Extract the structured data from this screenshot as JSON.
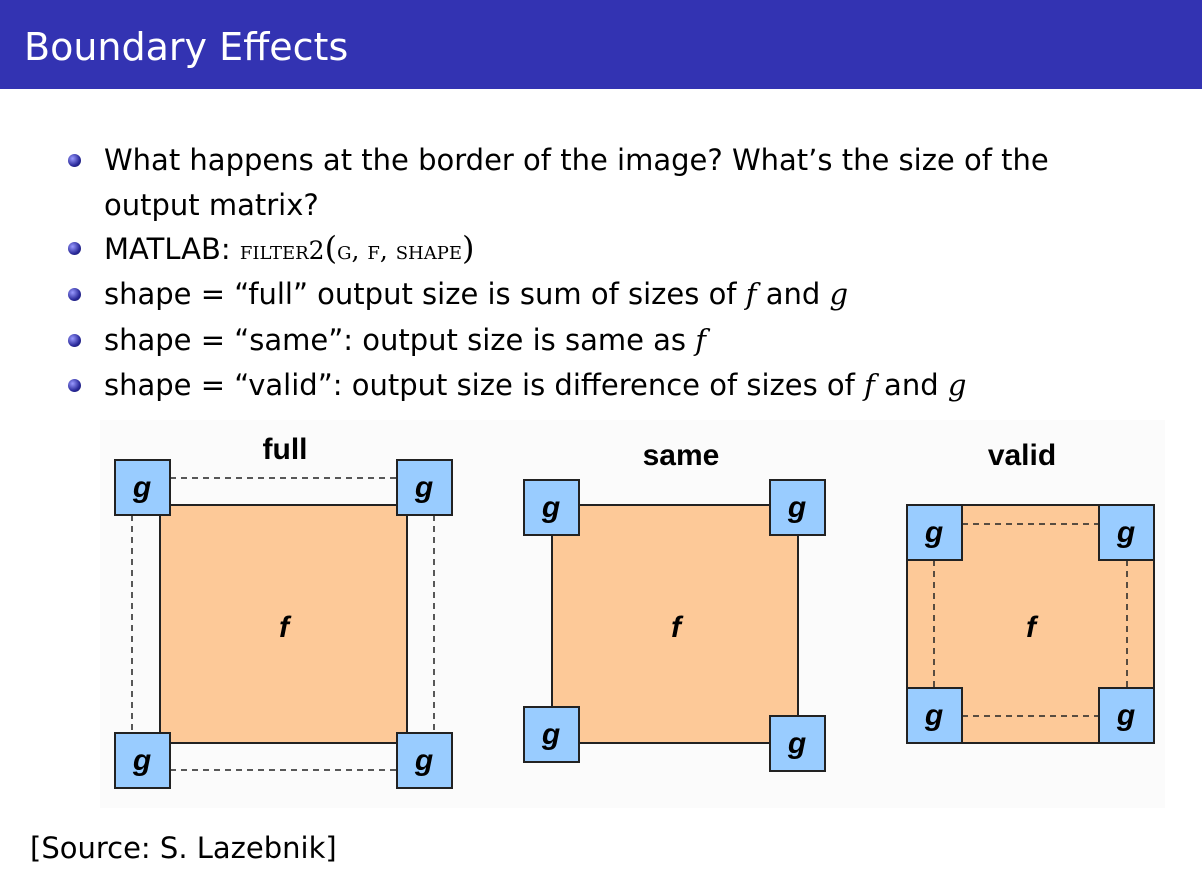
{
  "header": {
    "title": "Boundary Effects"
  },
  "bullets": [
    {
      "line1": "What happens at the border of the image? What’s the size of the",
      "line2": "output matrix?"
    },
    {
      "prefix": "MATLAB: ",
      "func": "filter2",
      "open": "(",
      "args": "g, f, shape",
      "close": ")"
    },
    {
      "prefix": "shape = “full” output size is sum of sizes of ",
      "v1": "f",
      "mid": " and ",
      "v2": "g"
    },
    {
      "prefix": "shape = “same”: output size is same as ",
      "v1": "f"
    },
    {
      "prefix": "shape = “valid”: output size is difference of sizes of ",
      "v1": "f",
      "mid": " and ",
      "v2": "g"
    }
  ],
  "diagram": {
    "panels": [
      {
        "title": "full",
        "f_label": "f",
        "g_label": "g"
      },
      {
        "title": "same",
        "f_label": "f",
        "g_label": "g"
      },
      {
        "title": "valid",
        "f_label": "f",
        "g_label": "g"
      }
    ],
    "colors": {
      "f_fill": "#fdc998",
      "g_fill": "#99ccff",
      "header": "#3333b2"
    }
  },
  "source": "[Source: S. Lazebnik]"
}
